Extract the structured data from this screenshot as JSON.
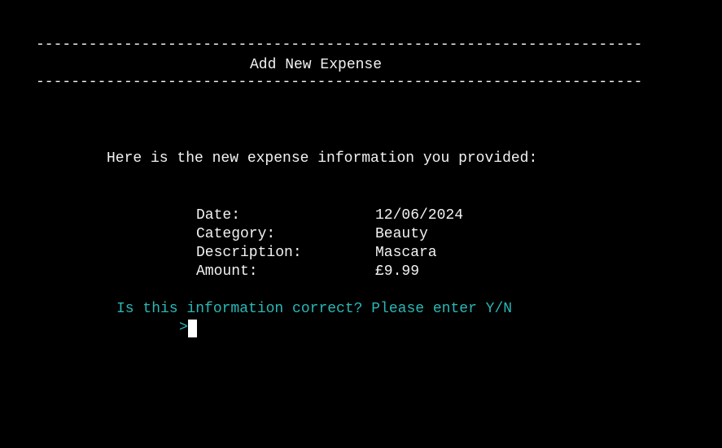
{
  "header": {
    "rule": "----------------------------------------------------------------------",
    "title": "Add New Expense"
  },
  "summary": {
    "intro": "Here is the new expense information you provided:",
    "fields": [
      {
        "label": "Date:",
        "value": "12/06/2024"
      },
      {
        "label": "Category:",
        "value": "Beauty"
      },
      {
        "label": "Description:",
        "value": "Mascara"
      },
      {
        "label": "Amount:",
        "value": "£9.99"
      }
    ]
  },
  "confirm": {
    "prompt": "Is this information correct? Please enter Y/N",
    "input_marker": ">",
    "input_value": ""
  },
  "colors": {
    "background": "#000000",
    "text": "#f2f2f2",
    "prompt_accent": "#2ab7b7",
    "cursor": "#ffffff"
  }
}
